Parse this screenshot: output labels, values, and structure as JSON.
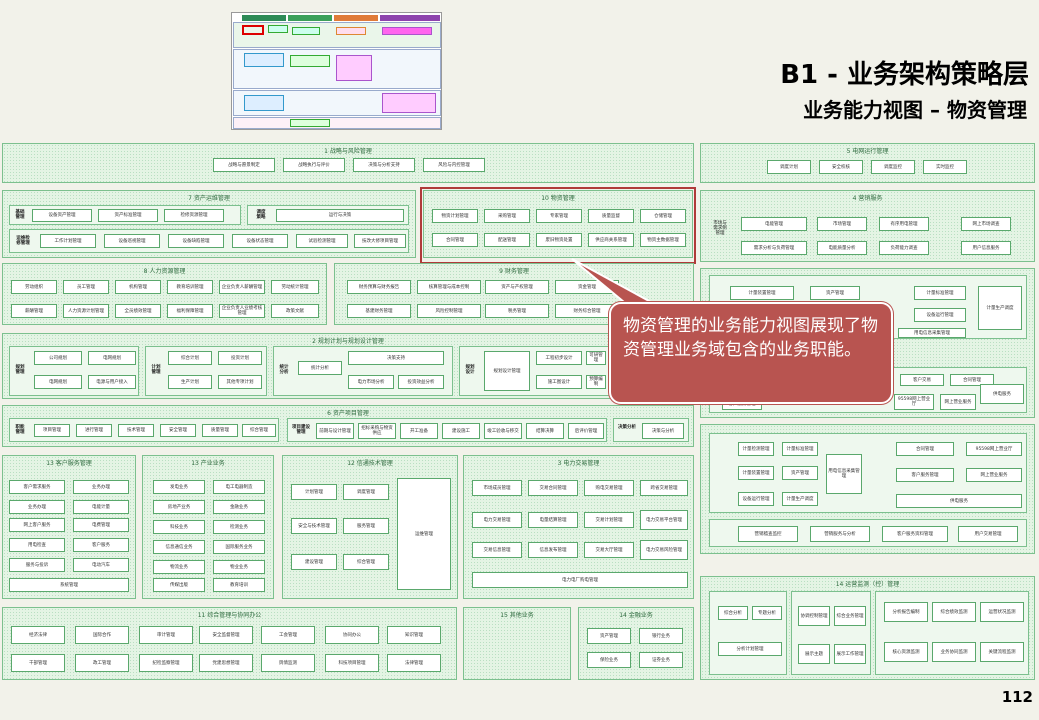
{
  "title": "B1 - 业务架构策略层",
  "subtitle": "业务能力视图 – 物资管理",
  "page_number": "112",
  "callout": "物资管理的业务能力视图展现了物资管理业务域包含的业务职能。",
  "sections": {
    "s1": {
      "title": "1 战略与风险管理",
      "items": [
        "战略与愿景制定",
        "战略执行与评价",
        "决策与分析支持",
        "风险与内控管理"
      ]
    },
    "s5": {
      "title": "5 电网运行管理",
      "items": [
        "调度计划",
        "安全校核",
        "调度监控",
        "实时监控"
      ]
    },
    "s7": {
      "title": "7 资产运维管理",
      "g1": "基础\n管理",
      "g1items": [
        "设备资产管理",
        "资产标准管理",
        "检修资源管理"
      ],
      "g2": "调度\n策略",
      "g2item": "运行与决策",
      "g3": "运维检\n修管理",
      "g3items": [
        "工作计划管理",
        "设备巡视管理",
        "设备缺陷管理",
        "设备状态管理",
        "试验检测管理",
        "技改大修项目管理"
      ]
    },
    "s10": {
      "title": "10 物资管理",
      "items": [
        "物资计划管理",
        "采购管理",
        "专家管理",
        "质量监督",
        "仓储管理",
        "合同管理",
        "配送管理",
        "废旧物资处置",
        "供应商关系管理",
        "物资主数据管理"
      ]
    },
    "s4": {
      "title": "4 营销服务",
      "left_label": "市场与\n需求侧\n管理",
      "items": [
        "电能管理",
        "市场管理",
        "有序用电管理",
        "网上市场调查",
        "需求分析与负荷管理",
        "电能质量分析",
        "负荷能力调查",
        "用户信息服务"
      ]
    },
    "s8": {
      "title": "8 人力资源管理",
      "items": [
        "劳动组织",
        "员工管理",
        "机构管理",
        "教育培训管理",
        "企业负责人薪酬管理",
        "劳动统计管理",
        "薪酬管理",
        "人力资源计划管理",
        "全员绩效管理",
        "福利保障管理",
        "企业负责人业绩考核管理",
        "政策文献"
      ]
    },
    "s9": {
      "title": "9 财务管理",
      "items": [
        "财务预算与财务报告",
        "核算管理与成本控制",
        "资产与产权管理",
        "资金管理",
        "基建财务管理",
        "风险控制管理",
        "税务管理",
        "财务综合管理"
      ]
    },
    "s2": {
      "title": "2 规划计划与规划设计管理",
      "g1": "规划\n管理",
      "g1items": [
        "公司规划",
        "电网规划",
        "电网规划",
        "电源与用户接入"
      ],
      "g2": "计划\n管理",
      "g2items": [
        "综合计划",
        "投资计划",
        "生产计划",
        "其他专项计划"
      ],
      "g3": "统计\n分析",
      "g3items": [
        "统计分析",
        "决策支持",
        "电力市场分析",
        "投资效益分析"
      ],
      "g4": "规划\n设计",
      "g4items": [
        "规划设计管理",
        "工程初步设计",
        "可研管理",
        "施工图设计",
        "预算编制"
      ]
    },
    "s6": {
      "title": "6 资产项目管理",
      "g1": "职能\n管理",
      "g1items": [
        "项目管理",
        "进行管理",
        "技术管理",
        "安全管理",
        "质量管理",
        "综合管理"
      ],
      "g2": "项目建设\n管理",
      "g2items": [
        "前期与设计管理",
        "招标采购与物资供应",
        "开工准备",
        "建设施工",
        "竣工验收与移交",
        "结算决算",
        "后评价管理"
      ],
      "g3": "决策分析",
      "g3item": "决策与分析"
    },
    "s13a": {
      "title": "13 客户服务管理",
      "items": [
        "客户需求服务",
        "业务办理",
        "业务办理",
        "电能计量",
        "网上客户服务",
        "电费管理",
        "用电检查",
        "客户服务",
        "服务与投诉",
        "电动汽车",
        "系统管理"
      ]
    },
    "s13b": {
      "title": "13 产业业务",
      "items": [
        "发电业务",
        "电工电器制造",
        "房地产业务",
        "金融业务",
        "科技业务",
        "检测业务",
        "信息通信业务",
        "国际服务业务",
        "物流业务",
        "物业业务",
        "传媒出版",
        "教育培训"
      ]
    },
    "s12": {
      "title": "12 信通技术管理",
      "items": [
        "计划管理",
        "调度管理",
        "安全与技术管理",
        "服务管理",
        "运维管理",
        "建设管理",
        "综合管理"
      ]
    },
    "s3": {
      "title": "3 电力交易管理",
      "items": [
        "市场成员管理",
        "交易合同管理",
        "购电交易管理",
        "跨省交易管理",
        "电力交易管理",
        "电量结算管理",
        "交易计划管理",
        "电力交易平台管理",
        "交易信息管理",
        "信息发布管理",
        "交易大厅管理",
        "电力交易风险管理",
        "电力电厂购电管理"
      ]
    },
    "s4b": {
      "items": [
        "计量装置管理",
        "资产管理",
        "计量标准管理",
        "计量检测管理",
        "设备运行管理",
        "计量生产调度",
        "用电信息采集管理",
        "客户交易",
        "合同管理",
        "客户服务管理",
        "95598网上营业厅",
        "网上营业服务",
        "供电服务"
      ],
      "bottom": [
        "营销稽查监控",
        "营销服务与分析",
        "客户服务资料管理",
        "用户交易管理"
      ]
    },
    "s14": {
      "title": "14 运营监测（控）管理",
      "items": [
        "综合分析",
        "专题分析",
        "协调控制管理",
        "综合业务管理",
        "分析计划管理",
        "展示主题",
        "展示工作管理",
        "分析报告编制",
        "综合绩效监测",
        "运营状况监测",
        "核心资源监测",
        "业务协同监测",
        "关键流程监测"
      ]
    },
    "s11": {
      "title": "11 综合管理与协同办公",
      "items": [
        "经济法律",
        "国际合作",
        "审计管理",
        "安全监督管理",
        "工会管理",
        "协同办公",
        "知识管理",
        "干部管理",
        "政工管理",
        "纪检监察管理",
        "党建思想管理",
        "舆情监测",
        "科技项目管理",
        "法律管理"
      ]
    },
    "s15": {
      "title": "15 其他业务"
    },
    "s14f": {
      "title": "14 金融业务",
      "items": [
        "资产管理",
        "银行业务",
        "保险业务",
        "证券业务"
      ]
    }
  }
}
